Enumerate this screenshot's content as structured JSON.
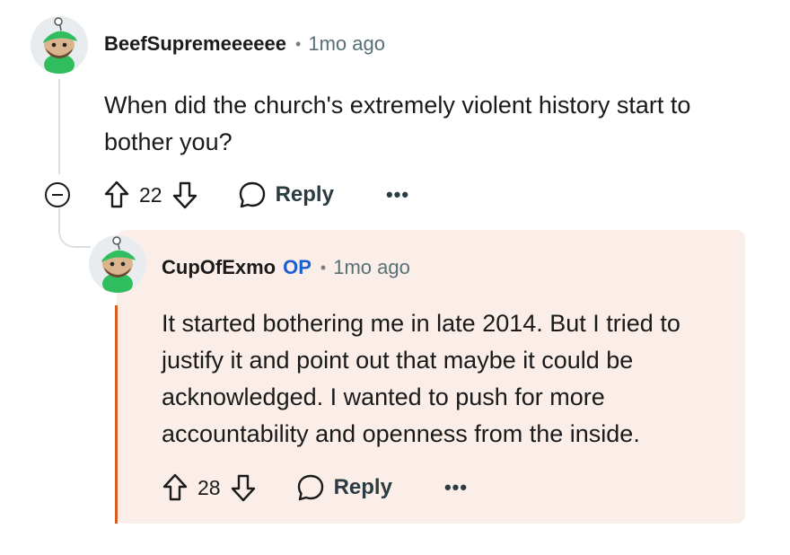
{
  "comments": [
    {
      "username": "BeefSupremeeeeee",
      "separator": "•",
      "time": "1mo ago",
      "body": "When did the church's extremely violent history start to bother you?",
      "score": "22",
      "reply_label": "Reply",
      "more_label": "•••"
    },
    {
      "username": "CupOfExmo",
      "op_badge": "OP",
      "separator": "•",
      "time": "1mo ago",
      "body": "It started bothering me in late 2014. But I tried to justify it and point out that maybe it could be acknowledged. I wanted to push for more accountability and openness from the inside.",
      "score": "28",
      "reply_label": "Reply",
      "more_label": "•••"
    }
  ],
  "icons": {
    "avatar": "snoo-avatar-icon",
    "upvote": "upvote-arrow-icon",
    "downvote": "downvote-arrow-icon",
    "reply": "speech-bubble-icon",
    "collapse": "collapse-minus-icon"
  },
  "colors": {
    "op_badge": "#1c5fd2",
    "reply_background": "#fbeee9",
    "op_accent_bar": "#d65c1f",
    "thread_line": "#dcdfe2"
  }
}
